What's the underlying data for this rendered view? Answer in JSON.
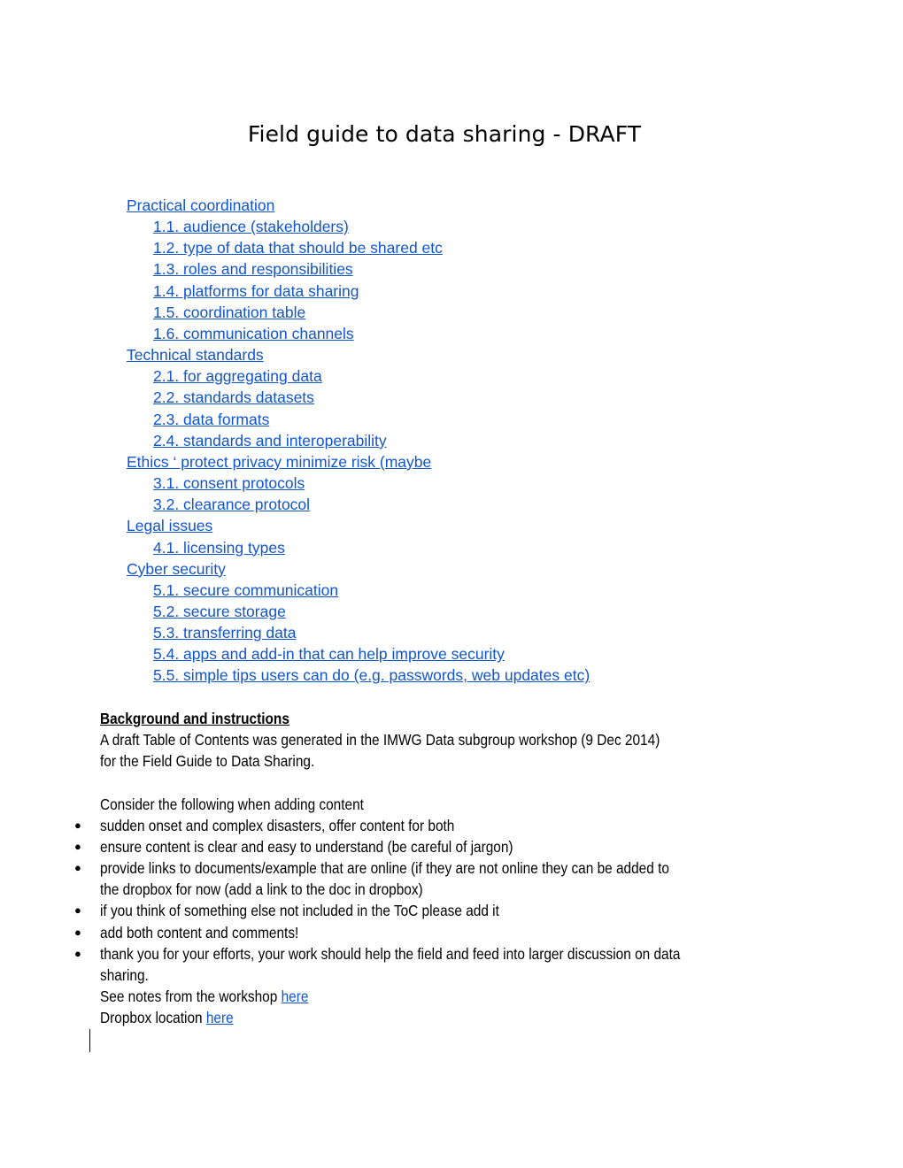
{
  "document": {
    "title": "Field guide to data sharing - DRAFT",
    "toc": [
      {
        "label": "Practical coordination",
        "level": 1
      },
      {
        "label": "1.1. audience (stakeholders)",
        "level": 2
      },
      {
        "label": "1.2. type of data that should be shared etc",
        "level": 2
      },
      {
        "label": "1.3. roles and responsibilities",
        "level": 2
      },
      {
        "label": "1.4. platforms for data sharing",
        "level": 2
      },
      {
        "label": "1.5. coordination table",
        "level": 2
      },
      {
        "label": "1.6. communication channels",
        "level": 2
      },
      {
        "label": "Technical standards",
        "level": 1
      },
      {
        "label": "2.1. for aggregating data",
        "level": 2
      },
      {
        "label": "2.2. standards datasets",
        "level": 2
      },
      {
        "label": "2.3. data formats",
        "level": 2
      },
      {
        "label": "2.4. standards and interoperability",
        "level": 2
      },
      {
        "label": "Ethics ‘ protect privacy minimize risk (maybe",
        "level": 1
      },
      {
        "label": "3.1. consent protocols",
        "level": 2
      },
      {
        "label": "3.2. clearance protocol",
        "level": 2
      },
      {
        "label": "Legal issues",
        "level": 1
      },
      {
        "label": "4.1. licensing types",
        "level": 2
      },
      {
        "label": "Cyber security",
        "level": 1
      },
      {
        "label": "5.1. secure communication",
        "level": 2
      },
      {
        "label": "5.2. secure storage",
        "level": 2
      },
      {
        "label": "5.3. transferring data",
        "level": 2
      },
      {
        "label": "5.4. apps and add-in that can help improve security",
        "level": 2
      },
      {
        "label": "5.5. simple tips users can do (e.g. passwords, web updates etc)",
        "level": 2
      }
    ],
    "background": {
      "heading": "Background and instructions",
      "intro_line1": "A draft  Table of Contents was generated in the IMWG Data subgroup workshop (9 Dec 2014)",
      "intro_line2": "for the Field Guide to Data Sharing.",
      "consider": "Consider  the following when adding content",
      "bullet_glyph": "●",
      "bullets": [
        [
          "sudden onset and complex disasters, offer content for both"
        ],
        [
          "ensure content is clear and easy to understand (be careful of jargon)"
        ],
        [
          "provide links to documents/example that are online (if they are not online they can be added to",
          "the dropbox for now (add a link to the doc in dropbox)"
        ],
        [
          "if you think of something else not included in the ToC please add it"
        ],
        [
          "add both content and comments!"
        ],
        [
          "thank you for your efforts, your work should help the field and feed into larger discussion on data",
          "sharing."
        ]
      ],
      "notes_prefix": "See notes from the workshop ",
      "notes_link": "here",
      "dropbox_prefix": "Dropbox location ",
      "dropbox_link": "here"
    },
    "colors": {
      "link": "#1155cc",
      "text": "#000000"
    }
  }
}
